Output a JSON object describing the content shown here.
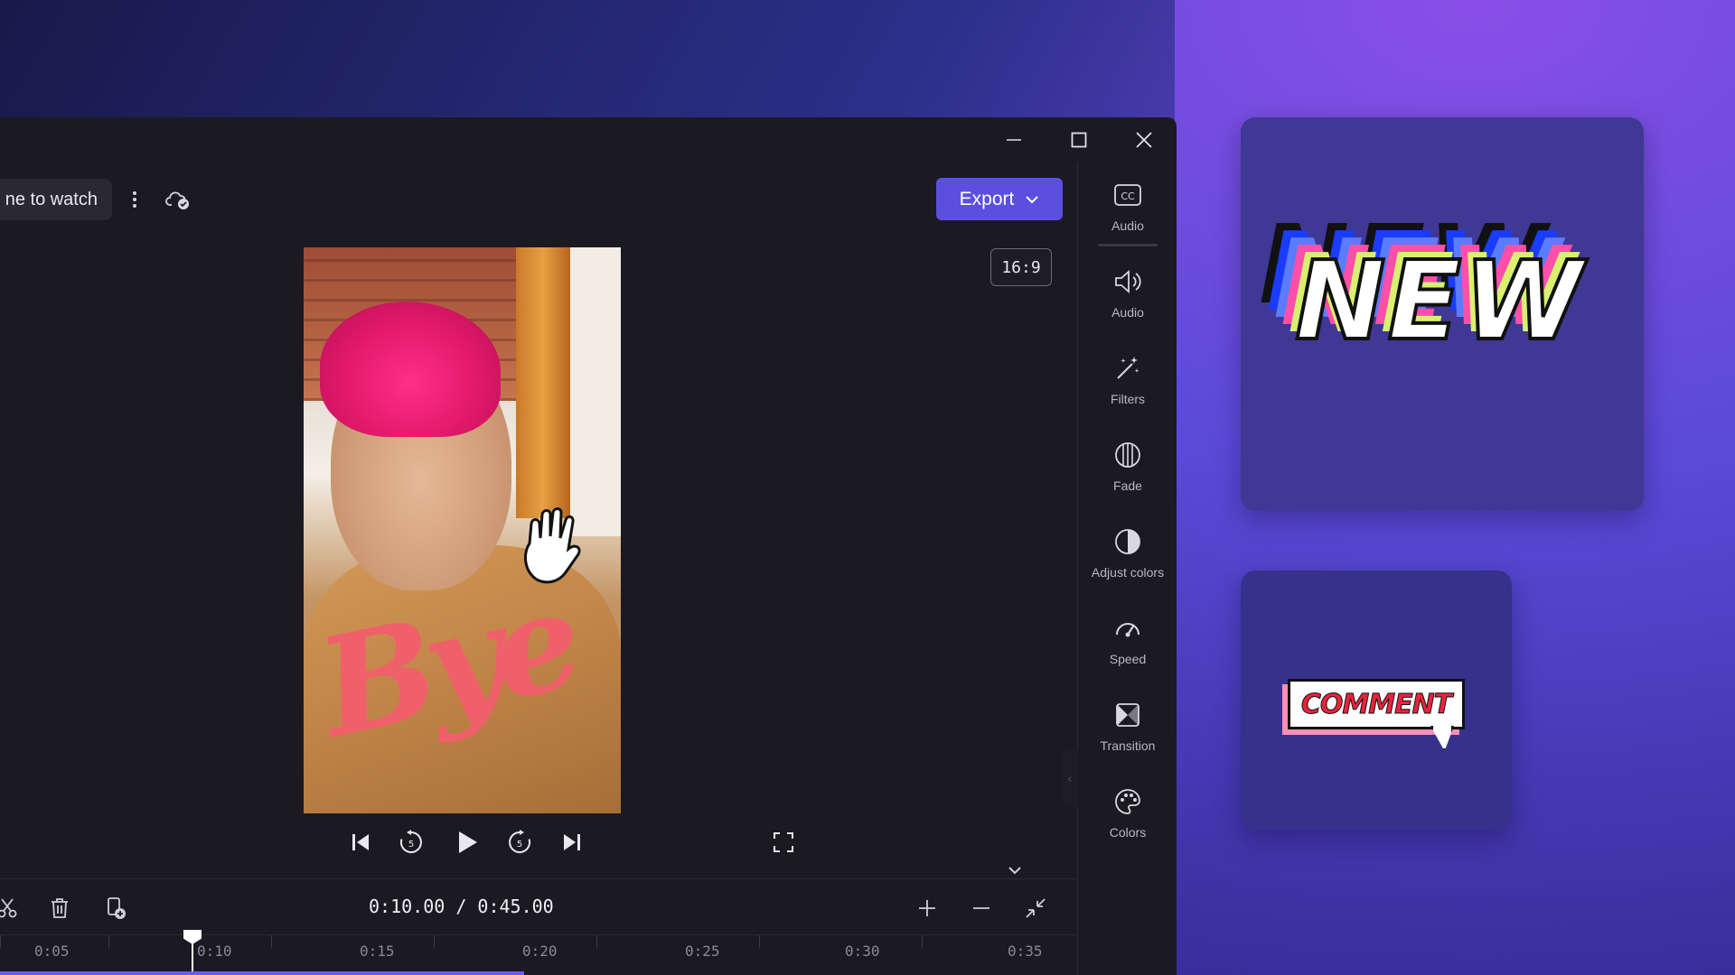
{
  "window": {
    "project_name": "ne to watch",
    "export_label": "Export",
    "aspect_ratio": "16:9"
  },
  "playback": {
    "timecode": "0:10.00 / 0:45.00",
    "progress_fraction": 0.222
  },
  "timeline": {
    "ticks": [
      "0:05",
      "0:10",
      "0:15",
      "0:20",
      "0:25",
      "0:30",
      "0:35"
    ]
  },
  "preview": {
    "sticker_text": "Bye"
  },
  "properties": {
    "items": [
      {
        "label": "Audio",
        "icon": "captions-icon"
      },
      {
        "label": "Audio",
        "icon": "speaker-icon"
      },
      {
        "label": "Filters",
        "icon": "magic-wand-icon"
      },
      {
        "label": "Fade",
        "icon": "fade-icon"
      },
      {
        "label": "Adjust colors",
        "icon": "contrast-icon"
      },
      {
        "label": "Speed",
        "icon": "speedometer-icon"
      },
      {
        "label": "Transition",
        "icon": "transition-icon"
      },
      {
        "label": "Colors",
        "icon": "palette-icon"
      }
    ]
  },
  "stickers": {
    "new_label": "NEW",
    "comment_label": "COMMENT"
  },
  "colors": {
    "accent": "#5b4fe0",
    "panel": "#1b1a22"
  }
}
